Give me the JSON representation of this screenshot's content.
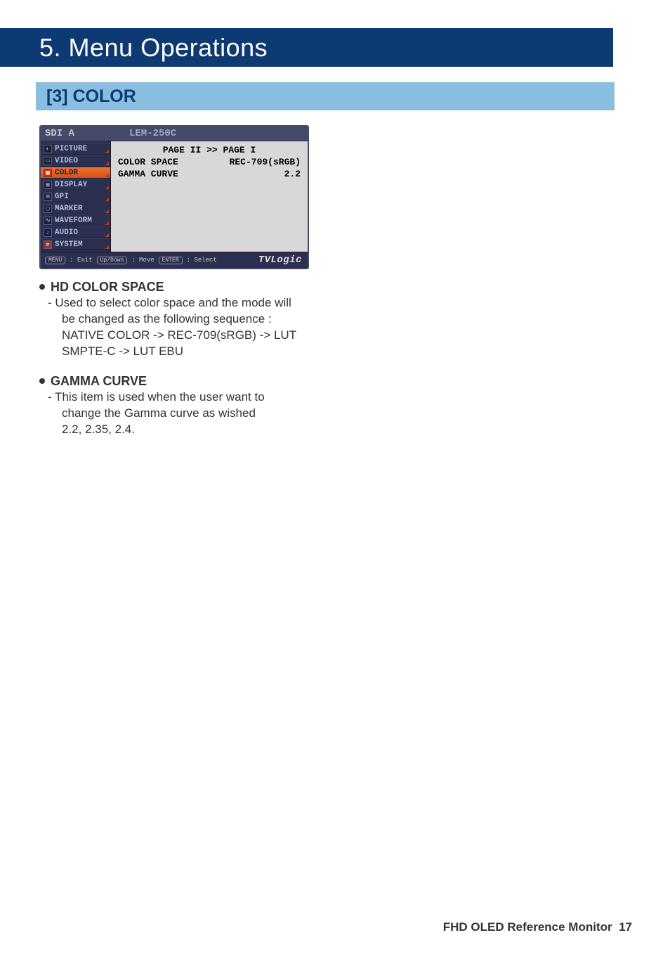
{
  "page": {
    "chapter_title": "5. Menu Operations",
    "section_title": "[3] COLOR",
    "footer_text": "FHD OLED Reference Monitor",
    "page_number": "17"
  },
  "osd": {
    "header_left": "SDI A",
    "header_mid": "LEM-250C",
    "nav": {
      "items": [
        {
          "label": "PICTURE"
        },
        {
          "label": "VIDEO"
        },
        {
          "label": "COLOR"
        },
        {
          "label": "DISPLAY"
        },
        {
          "label": "GPI"
        },
        {
          "label": "MARKER"
        },
        {
          "label": "WAVEFORM"
        },
        {
          "label": "AUDIO"
        },
        {
          "label": "SYSTEM"
        }
      ],
      "selected_index": 2
    },
    "page2_rows": {
      "pager": "PAGE II >> PAGE I",
      "row0": {
        "label": "COLOR SPACE",
        "value": "REC-709(sRGB)"
      },
      "row1": {
        "label": "GAMMA CURVE",
        "value": "2.2"
      }
    },
    "footer": {
      "key0": "MENU",
      "hint0": ": Exit",
      "key1": "Up/Down",
      "hint1": ": Move",
      "key2": "ENTER",
      "hint2": ": Select",
      "brand": "TVLogic"
    }
  },
  "descriptions": [
    {
      "heading": "HD COLOR SPACE",
      "body_first": "- Used to select color space and the mode will",
      "body_lines": [
        "be changed as the following sequence :",
        "NATIVE COLOR -> REC-709(sRGB) -> LUT",
        "SMPTE-C -> LUT EBU"
      ]
    },
    {
      "heading": "GAMMA CURVE",
      "body_first": "- This item is used when the user want to",
      "body_lines": [
        "change the Gamma curve as wished",
        "2.2, 2.35, 2.4."
      ]
    }
  ]
}
